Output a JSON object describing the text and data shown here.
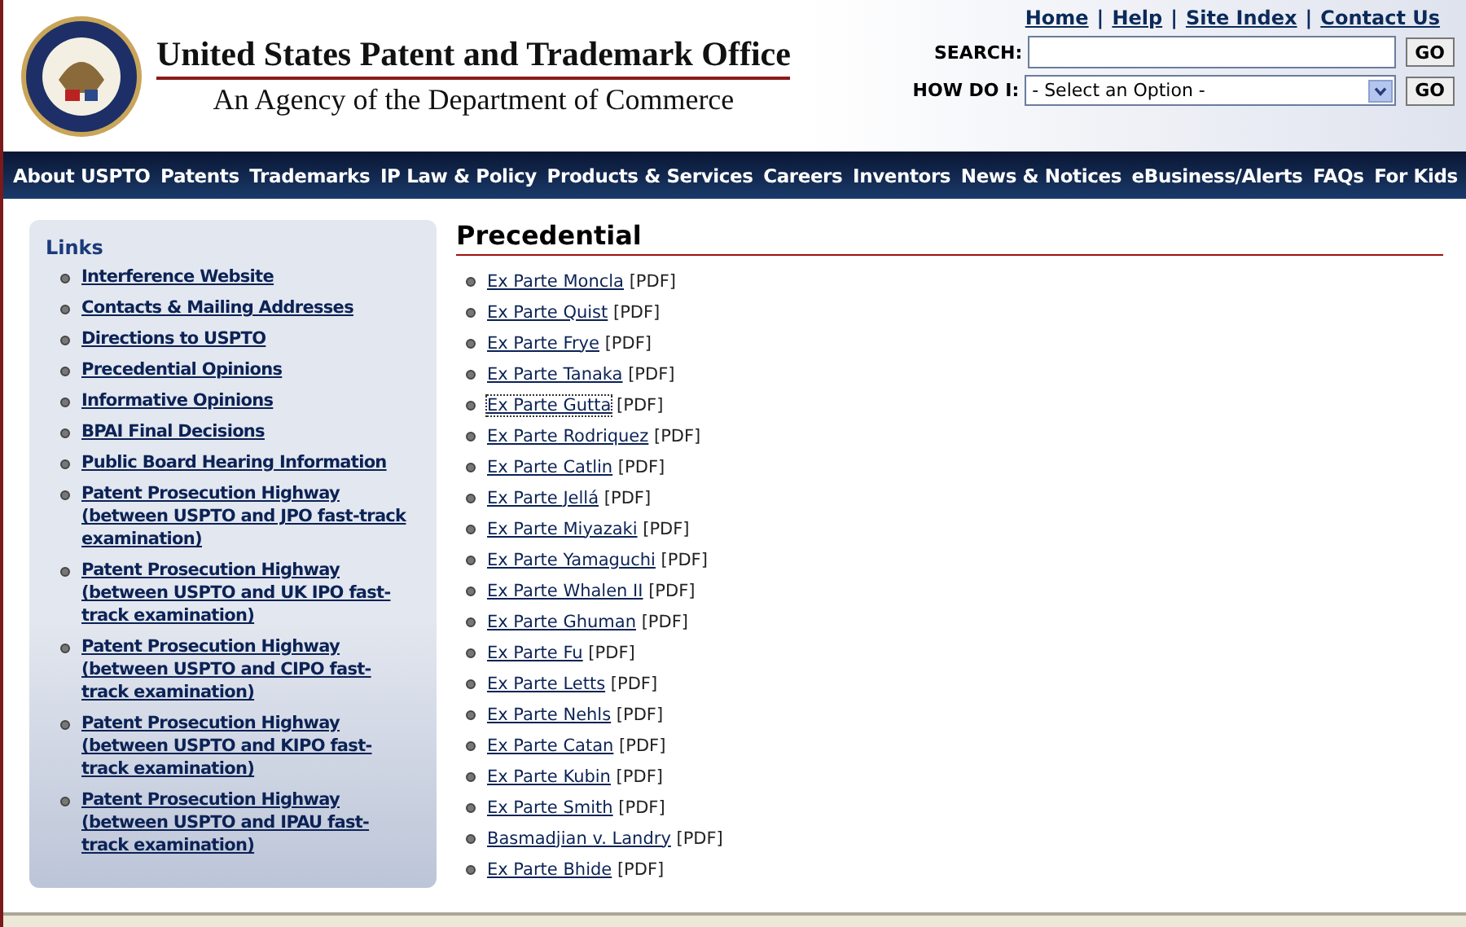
{
  "header": {
    "title": "United States Patent and Trademark Office",
    "subtitle": "An Agency of the Department of Commerce",
    "top_links": [
      "Home",
      "Help",
      "Site Index",
      "Contact Us"
    ],
    "top_link_separators": [
      "|",
      "|",
      "|"
    ],
    "search": {
      "label": "SEARCH:",
      "button": "GO"
    },
    "how_do_i": {
      "label": "HOW DO I:",
      "value": "- Select an Option -",
      "button": "GO"
    }
  },
  "nav": [
    "About USPTO",
    "Patents",
    "Trademarks",
    "IP Law & Policy",
    "Products & Services",
    "Careers",
    "Inventors",
    "News & Notices",
    "eBusiness/Alerts",
    "FAQs",
    "For Kids"
  ],
  "sidebar": {
    "title": "Links",
    "items": [
      "Interference Website",
      "Contacts & Mailing Addresses",
      "Directions to USPTO",
      "Precedential Opinions",
      "Informative Opinions",
      "BPAI Final Decisions",
      "Public Board Hearing Information",
      "Patent Prosecution Highway (between USPTO and JPO fast-track examination)",
      "Patent Prosecution Highway (between USPTO and UK IPO fast-track examination)",
      "Patent Prosecution Highway (between USPTO and CIPO fast-track examination)",
      "Patent Prosecution Highway (between USPTO and KIPO fast-track examination)",
      "Patent Prosecution Highway (between USPTO and IPAU fast-track examination)"
    ]
  },
  "main": {
    "heading": "Precedential",
    "items": [
      {
        "link": "Ex Parte Moncla",
        "suffix": "[PDF]",
        "focused": false
      },
      {
        "link": "Ex Parte Quist",
        "suffix": "[PDF]",
        "focused": false
      },
      {
        "link": "Ex Parte Frye",
        "suffix": "[PDF]",
        "focused": false
      },
      {
        "link": "Ex Parte Tanaka",
        "suffix": "[PDF]",
        "focused": false
      },
      {
        "link": "Ex Parte Gutta",
        "suffix": "[PDF]",
        "focused": true
      },
      {
        "link": "Ex Parte Rodriquez",
        "suffix": "[PDF]",
        "focused": false
      },
      {
        "link": "Ex Parte Catlin",
        "suffix": "[PDF]",
        "focused": false
      },
      {
        "link": "Ex Parte Jellá",
        "suffix": "[PDF]",
        "focused": false
      },
      {
        "link": "Ex Parte Miyazaki",
        "suffix": "[PDF]",
        "focused": false
      },
      {
        "link": "Ex Parte Yamaguchi",
        "suffix": "[PDF]",
        "focused": false
      },
      {
        "link": "Ex Parte Whalen II",
        "suffix": "[PDF]",
        "focused": false
      },
      {
        "link": "Ex Parte Ghuman",
        "suffix": "[PDF]",
        "focused": false
      },
      {
        "link": "Ex Parte Fu",
        "suffix": "[PDF]",
        "focused": false
      },
      {
        "link": "Ex Parte Letts",
        "suffix": "[PDF]",
        "focused": false
      },
      {
        "link": "Ex Parte Nehls",
        "suffix": "[PDF]",
        "focused": false
      },
      {
        "link": "Ex Parte Catan",
        "suffix": "[PDF]",
        "focused": false
      },
      {
        "link": "Ex Parte Kubin",
        "suffix": "[PDF]",
        "focused": false
      },
      {
        "link": "Ex Parte Smith",
        "suffix": "[PDF]",
        "focused": false
      },
      {
        "link": "Basmadjian v. Landry",
        "suffix": "[PDF]",
        "focused": false
      },
      {
        "link": "Ex Parte Bhide",
        "suffix": "[PDF]",
        "focused": false
      }
    ]
  }
}
